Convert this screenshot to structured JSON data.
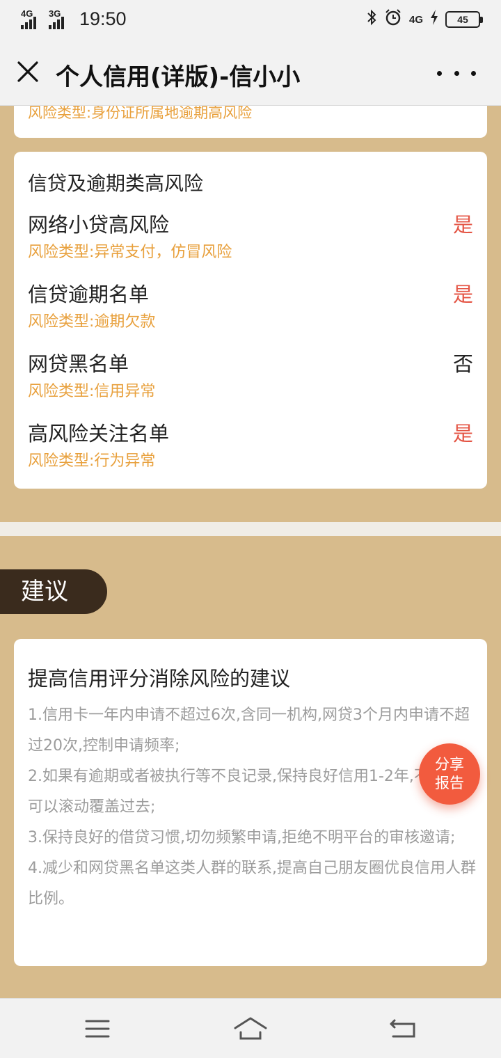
{
  "status_bar": {
    "signal1": "4G",
    "signal2": "3G",
    "time": "19:50",
    "net": "4G",
    "battery": "45"
  },
  "nav": {
    "title": "个人信用(详版)-信小小",
    "icons": [
      "close-icon",
      "more-icon"
    ]
  },
  "top_card": {
    "risk_type": "风险类型:身份证所属地逾期高风险"
  },
  "risk_card": {
    "title": "信贷及逾期类高风险",
    "items": [
      {
        "name": "网络小贷高风险",
        "value": "是",
        "risk_type": "风险类型:异常支付，仿冒风险"
      },
      {
        "name": "信贷逾期名单",
        "value": "是",
        "risk_type": "风险类型:逾期欠款"
      },
      {
        "name": "网贷黑名单",
        "value": "否",
        "risk_type": "风险类型:信用异常"
      },
      {
        "name": "高风险关注名单",
        "value": "是",
        "risk_type": "风险类型:行为异常"
      }
    ]
  },
  "advice_section": {
    "badge": "建议",
    "title": "提高信用评分消除风险的建议",
    "lines": [
      "1.信用卡一年内申请不超过6次,含同一机构,网贷3个月内申请不超过20次,控制申请频率;",
      "2.如果有逾期或者被执行等不良记录,保持良好信用1-2年,不良记录可以滚动覆盖过去;",
      "3.保持良好的借贷习惯,切勿频繁申请,拒绝不明平台的审核邀请;",
      "4.减少和网贷黑名单这类人群的联系,提高自己朋友圈优良信用人群比例。"
    ]
  },
  "share_button": {
    "line1": "分享",
    "line2": "报告"
  },
  "colors": {
    "background": "#d7bb8c",
    "accent_orange": "#e8a03c",
    "yes_red": "#e45545",
    "badge_dark": "#3a2b1d",
    "share_red": "#f25b3e"
  },
  "system_nav": [
    "menu-icon",
    "home-icon",
    "back-icon"
  ]
}
